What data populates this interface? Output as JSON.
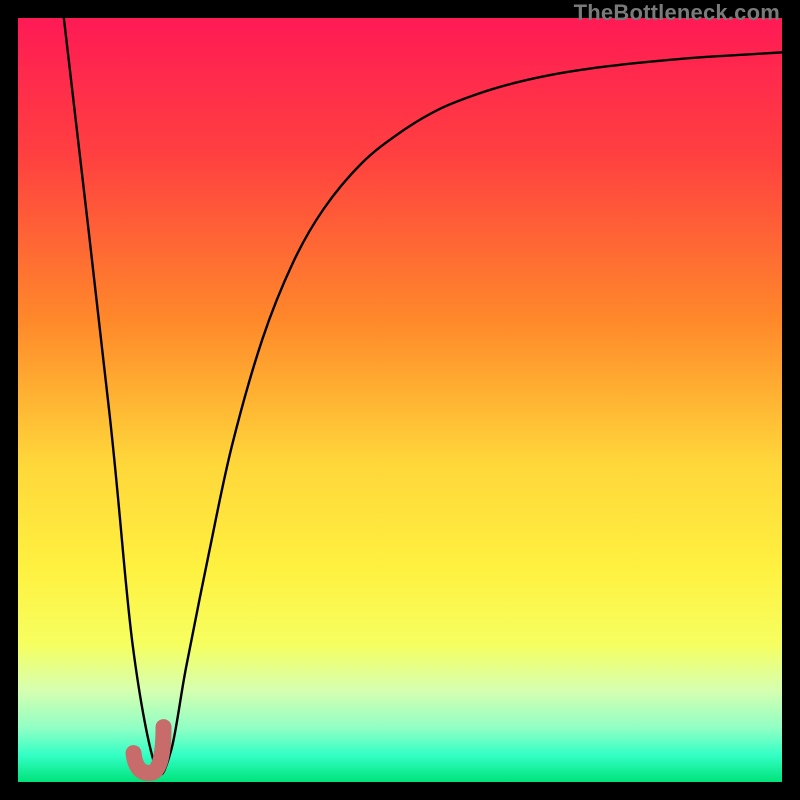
{
  "watermark": "TheBottleneck.com",
  "colors": {
    "frame": "#000000",
    "curve": "#000000",
    "checkmark": "#c76b6b",
    "gradient_stops": [
      {
        "offset": 0.0,
        "color": "#ff1a55"
      },
      {
        "offset": 0.18,
        "color": "#ff4040"
      },
      {
        "offset": 0.4,
        "color": "#ff8a2a"
      },
      {
        "offset": 0.58,
        "color": "#ffd63a"
      },
      {
        "offset": 0.72,
        "color": "#fff140"
      },
      {
        "offset": 0.82,
        "color": "#f6ff60"
      },
      {
        "offset": 0.88,
        "color": "#d6ffb0"
      },
      {
        "offset": 0.93,
        "color": "#8fffc5"
      },
      {
        "offset": 0.965,
        "color": "#33ffc5"
      },
      {
        "offset": 1.0,
        "color": "#00e37a"
      }
    ]
  },
  "chart_data": {
    "type": "line",
    "title": "",
    "xlabel": "",
    "ylabel": "",
    "xlim": [
      0,
      100
    ],
    "ylim": [
      0,
      100
    ],
    "series": [
      {
        "name": "bottleneck-curve",
        "x": [
          6,
          12,
          15,
          18,
          20,
          22,
          25,
          28,
          32,
          36,
          40,
          45,
          50,
          55,
          60,
          65,
          70,
          75,
          80,
          85,
          90,
          95,
          100
        ],
        "y": [
          100,
          48,
          18,
          2,
          4,
          15,
          30,
          44,
          58,
          68,
          75,
          81,
          85,
          88,
          90,
          91.5,
          92.6,
          93.4,
          94,
          94.5,
          94.9,
          95.2,
          95.5
        ]
      }
    ],
    "marker": {
      "name": "optimal-check",
      "x": 18,
      "y": 3
    }
  }
}
